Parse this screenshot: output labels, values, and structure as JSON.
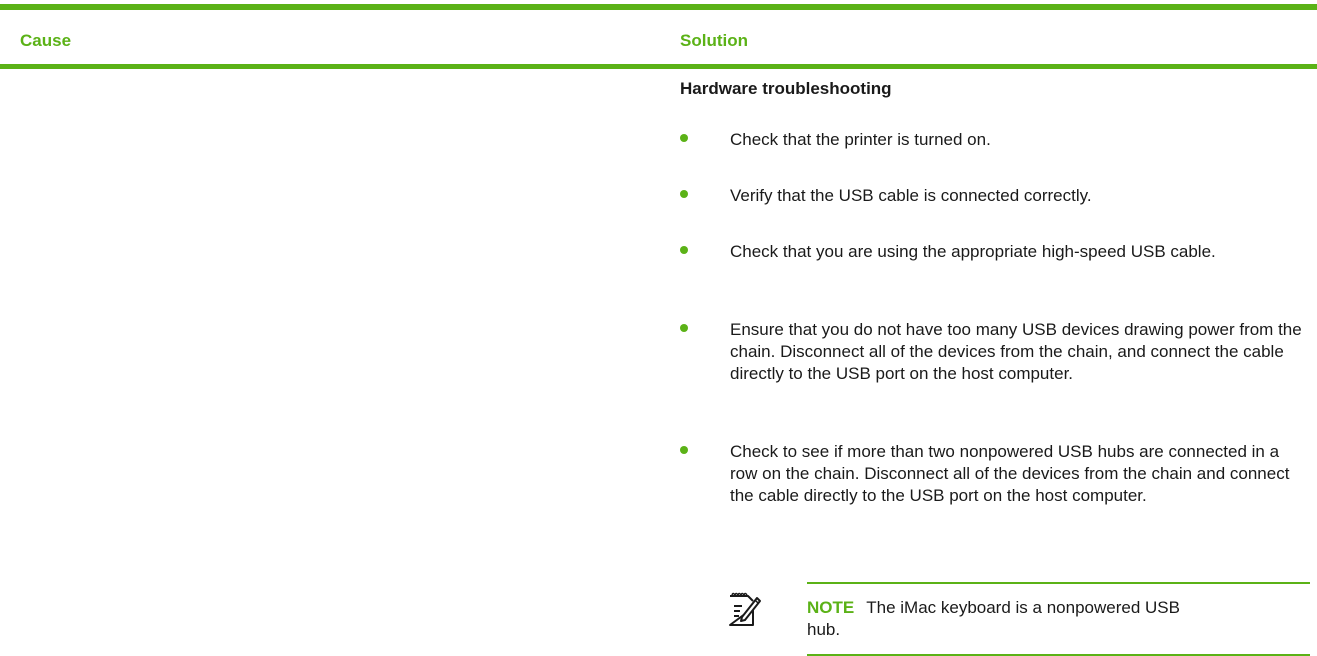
{
  "table": {
    "headers": {
      "cause": "Cause",
      "solution": "Solution"
    }
  },
  "solution": {
    "heading": "Hardware troubleshooting",
    "bullets": [
      "Check that the printer is turned on.",
      "Verify that the USB cable is connected correctly.",
      "Check that you are using the appropriate high-speed USB cable.",
      "Ensure that you do not have too many USB devices drawing power from the chain. Disconnect all of the devices from the chain, and connect the cable directly to the USB port on the host computer.",
      "Check to see if more than two nonpowered USB hubs are connected in a row on the chain. Disconnect all of the devices from the chain and connect the cable directly to the USB port on the host computer."
    ],
    "note": {
      "icon": "note-icon",
      "label": "NOTE",
      "text": "The iMac keyboard is a nonpowered USB hub."
    }
  },
  "colors": {
    "accent": "#5bb217",
    "text": "#1a1a1a"
  }
}
